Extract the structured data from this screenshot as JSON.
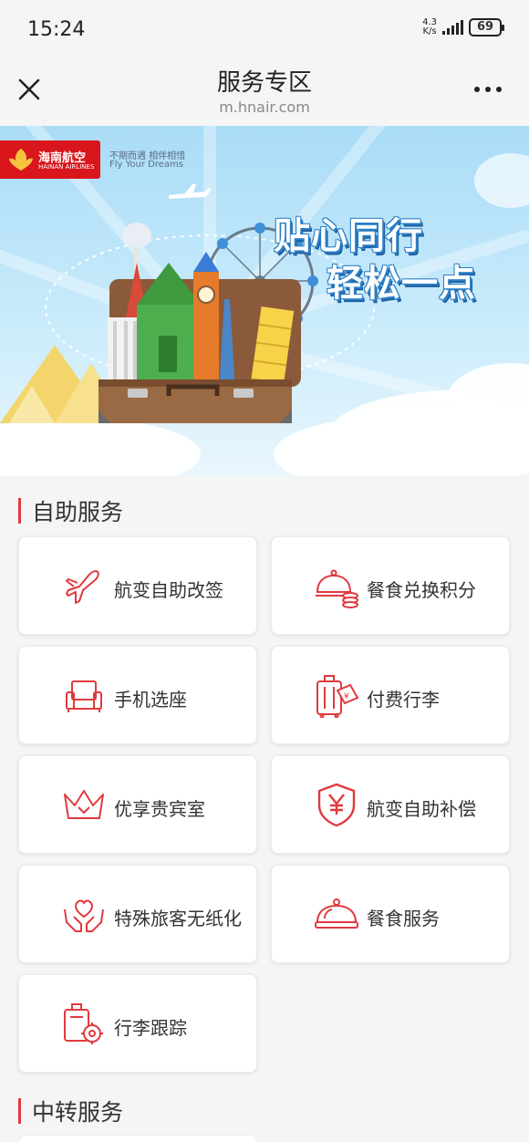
{
  "status_bar": {
    "time": "15:24",
    "net_speed_value": "4.3",
    "net_speed_unit": "K/s",
    "battery": "69"
  },
  "nav": {
    "title": "服务专区",
    "url": "m.hnair.com",
    "close_icon": "close-icon",
    "more_icon": "more-icon"
  },
  "banner": {
    "logo_cn": "海南航空",
    "logo_en": "HAINAN AIRLINES",
    "slogan_cn": "不期而遇 相伴相惜",
    "slogan_en": "Fly Your Dreams",
    "headline_line1": "贴心同行",
    "headline_line2": "轻松一点"
  },
  "sections": [
    {
      "title": "自助服务",
      "items": [
        {
          "label": "航变自助改签",
          "icon": "airplane-icon"
        },
        {
          "label": "餐食兑换积分",
          "icon": "meal-points-icon"
        },
        {
          "label": "手机选座",
          "icon": "seat-icon"
        },
        {
          "label": "付费行李",
          "icon": "paid-luggage-icon"
        },
        {
          "label": "优享贵宾室",
          "icon": "crown-icon"
        },
        {
          "label": "航变自助补偿",
          "icon": "yen-shield-icon"
        },
        {
          "label": "特殊旅客无纸化",
          "icon": "heart-hands-icon"
        },
        {
          "label": "餐食服务",
          "icon": "cloche-icon"
        },
        {
          "label": "行李跟踪",
          "icon": "luggage-track-icon"
        }
      ]
    },
    {
      "title": "中转服务"
    }
  ],
  "colors": {
    "accent": "#e03a3e",
    "brand_red": "#d9161c",
    "background": "#f5f5f5"
  }
}
